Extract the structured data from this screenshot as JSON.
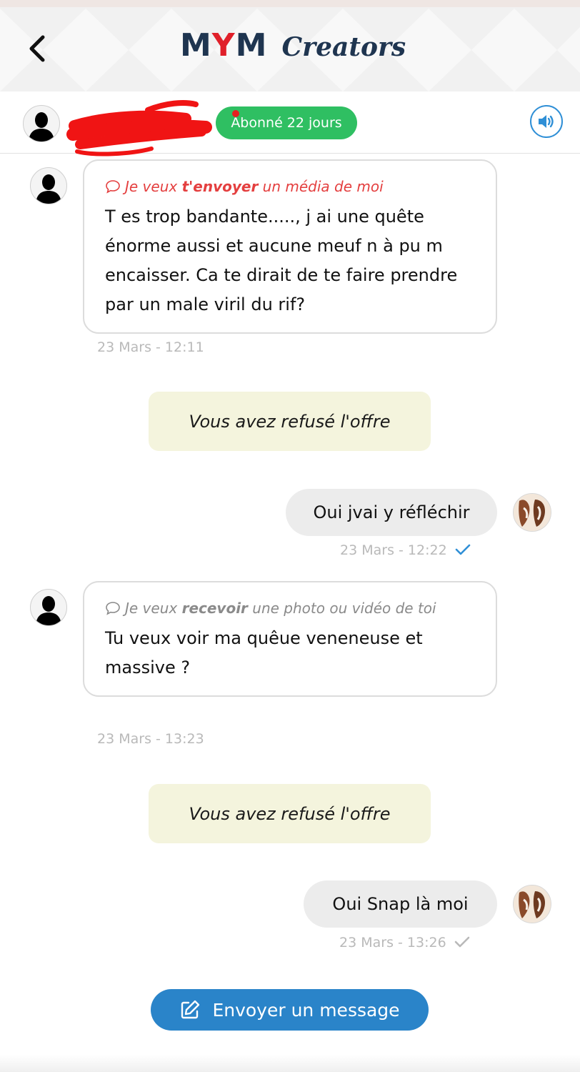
{
  "header": {
    "logo_mym_m1": "M",
    "logo_mym_y": "Y",
    "logo_mym_m2": "M",
    "logo_creators": "Creators"
  },
  "subheader": {
    "subscription_badge": "Abonné 22 jours"
  },
  "messages": [
    {
      "type": "incoming",
      "request_parts": [
        "Je veux ",
        "t'envoyer",
        " un média de moi"
      ],
      "request_color": "#e43f3f",
      "text": "T es trop bandante....., j ai une quête énorme aussi et aucune meuf n à pu m encaisser. Ca te dirait de te faire prendre par un male viril du rif?",
      "timestamp": "23 Mars - 12:11"
    },
    {
      "type": "system",
      "text": "Vous avez refusé l'offre"
    },
    {
      "type": "outgoing",
      "text": "Oui jvai y réfléchir",
      "timestamp": "23 Mars - 12:22",
      "status_icon": "check-icon",
      "status_color": "#2f8fd6"
    },
    {
      "type": "incoming",
      "request_parts": [
        "Je veux ",
        "recevoir",
        " une photo ou vidéo de toi"
      ],
      "request_color": "#8a8a8a",
      "text": "Tu veux voir ma quêue veneneuse et massive ?",
      "timestamp": "23 Mars - 13:23"
    },
    {
      "type": "system",
      "text": "Vous avez refusé l'offre"
    },
    {
      "type": "outgoing",
      "text": "Oui Snap là moi",
      "timestamp": "23 Mars - 13:26",
      "status_icon": "check-icon",
      "status_color": "#b9b9b9"
    }
  ],
  "footer": {
    "send_button_label": "Envoyer un message",
    "send_button_icon": "edit-icon"
  },
  "colors": {
    "brand_dark": "#1f3550",
    "brand_red": "#e0202a",
    "badge_green": "#2fbf62",
    "accent_blue": "#2a84c9",
    "system_bg": "#f4f4dd"
  }
}
